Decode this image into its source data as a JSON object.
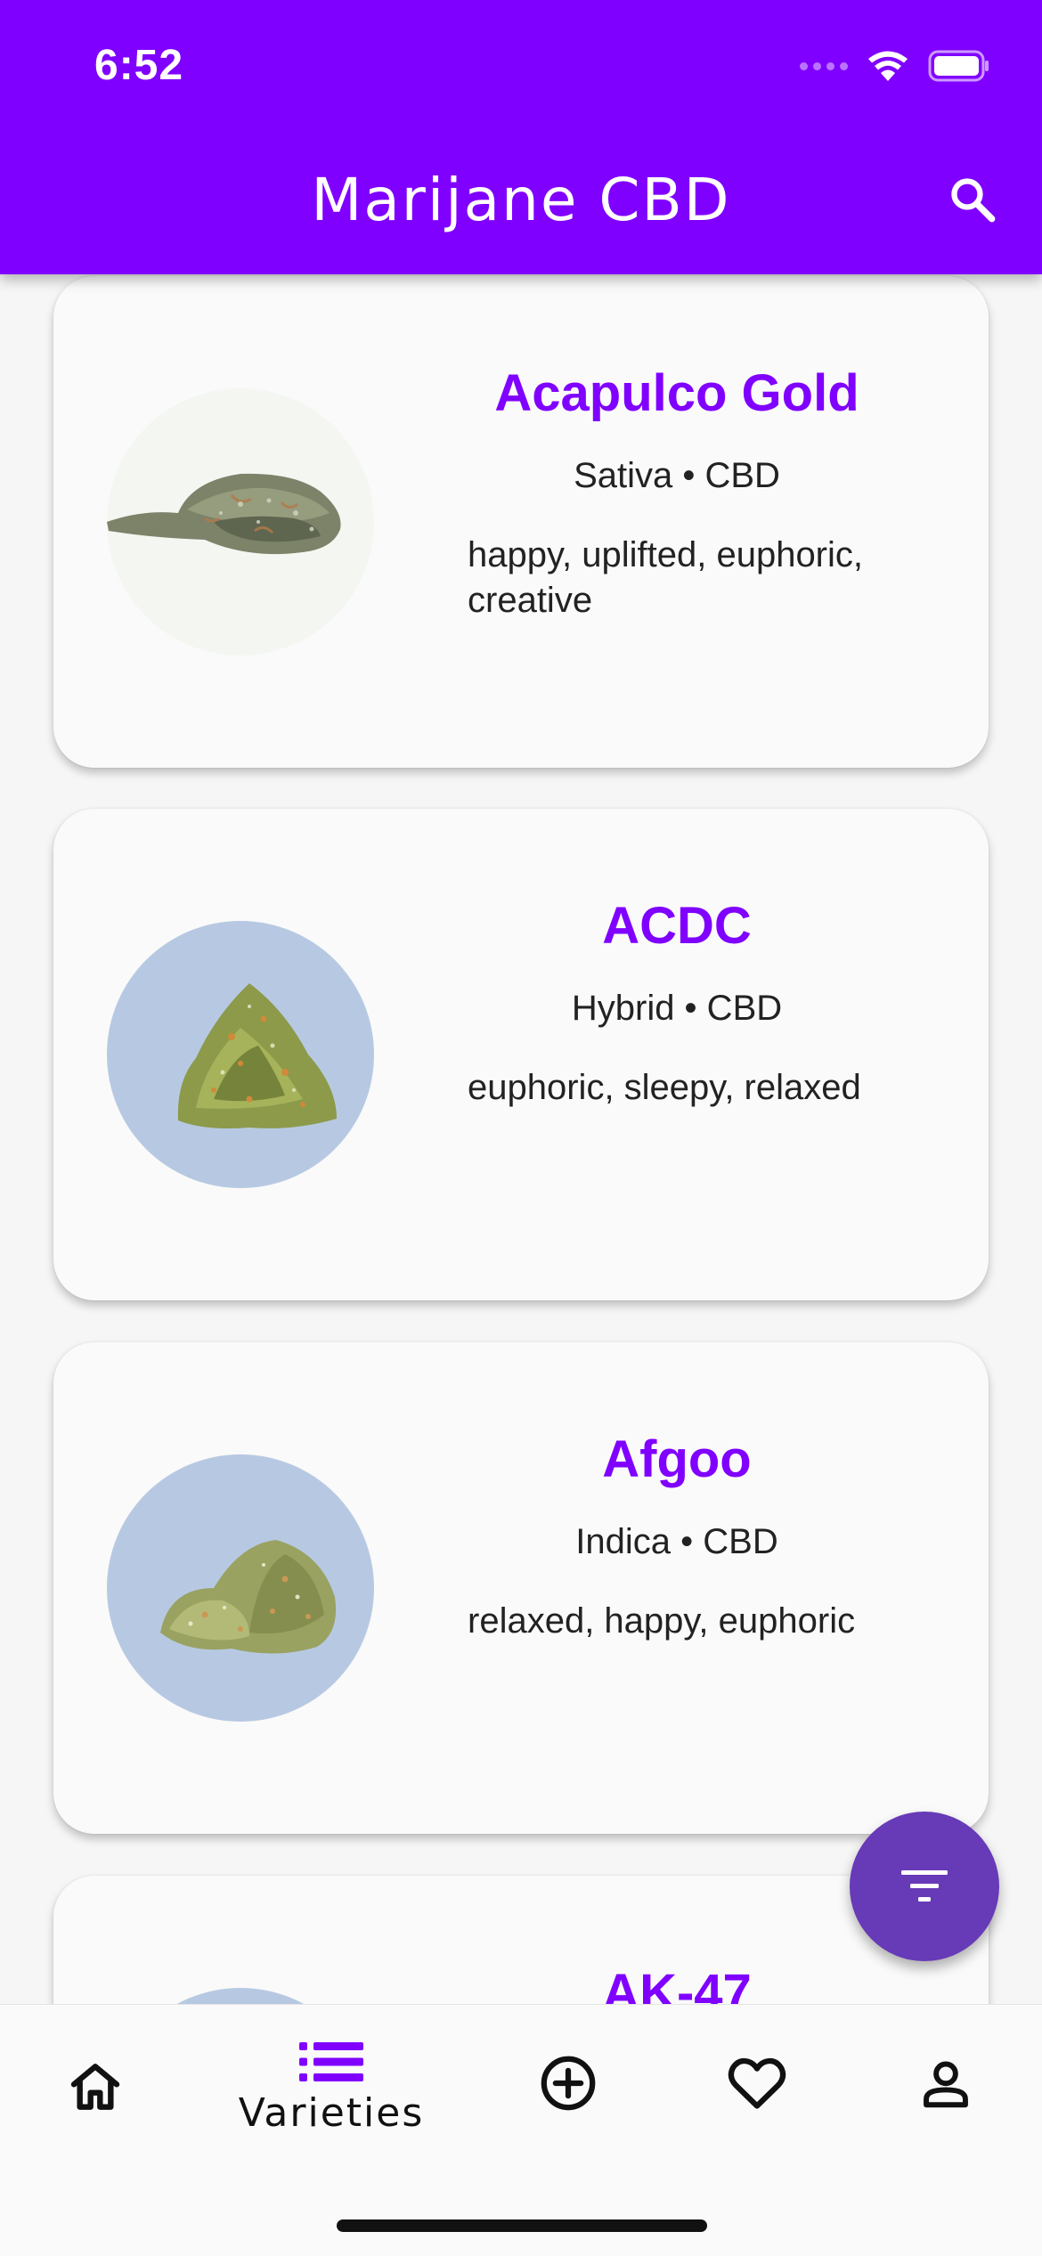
{
  "status_bar": {
    "time": "6:52"
  },
  "header": {
    "title": "Marijane CBD",
    "search_icon": "search-icon"
  },
  "colors": {
    "primary": "#8000ff",
    "fab": "#673ab7",
    "card_bg": "#fafafa",
    "image_bg_blue": "#b7c9e2"
  },
  "strains": [
    {
      "name": "Acapulco Gold",
      "type": "Sativa • CBD",
      "effects": "happy, uplifted, euphoric, creative"
    },
    {
      "name": "ACDC",
      "type": "Hybrid • CBD",
      "effects": "euphoric, sleepy, relaxed"
    },
    {
      "name": "Afgoo",
      "type": "Indica • CBD",
      "effects": "relaxed, happy, euphoric"
    },
    {
      "name": "AK-47",
      "type": "",
      "effects": ""
    }
  ],
  "fab": {
    "icon": "filter-icon"
  },
  "bottom_nav": {
    "items": [
      {
        "icon": "home-icon",
        "label": ""
      },
      {
        "icon": "list-icon",
        "label": "Varieties",
        "active": true
      },
      {
        "icon": "add-circle-icon",
        "label": ""
      },
      {
        "icon": "heart-icon",
        "label": ""
      },
      {
        "icon": "person-icon",
        "label": ""
      }
    ]
  }
}
